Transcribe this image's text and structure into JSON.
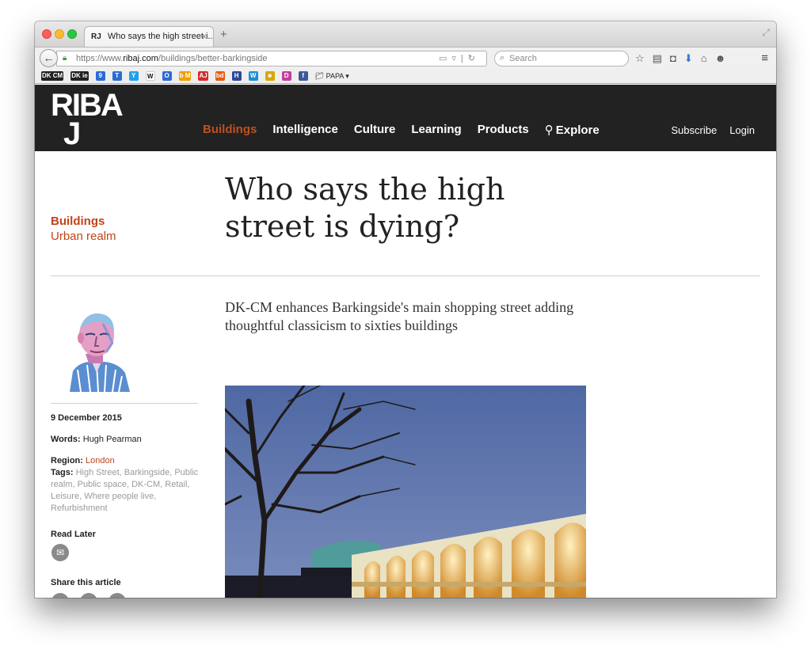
{
  "browser": {
    "tab_favicon": "RJ",
    "tab_title": "Who says the high street i...",
    "tab_close": "×",
    "new_tab": "+",
    "url_prefix": "https://www.",
    "url_host": "ribaj.com",
    "url_path": "/buildings/better-barkingside",
    "search_placeholder": "Search",
    "bookmarks": [
      {
        "label": "DK CM",
        "color": "#222222"
      },
      {
        "label": "DK ie",
        "color": "#222222"
      },
      {
        "label": "9",
        "color": "#2b6bd6"
      },
      {
        "label": "T",
        "color": "#2b6bd6"
      },
      {
        "label": "Y",
        "color": "#1da1f2"
      },
      {
        "label": "W",
        "color": "#ffffff"
      },
      {
        "label": "O",
        "color": "#2b6bd6"
      },
      {
        "label": "b M",
        "color": "#f0a000"
      },
      {
        "label": "AJ",
        "color": "#d72a2a"
      },
      {
        "label": "bd",
        "color": "#e85c0d"
      },
      {
        "label": "H",
        "color": "#2a4a9a"
      },
      {
        "label": "W",
        "color": "#1a8fd8"
      },
      {
        "label": "■",
        "color": "#d8a800"
      },
      {
        "label": "D",
        "color": "#c040a0"
      },
      {
        "label": "f",
        "color": "#3b5998"
      }
    ],
    "bookmark_folder": "PAPA"
  },
  "site": {
    "logo_line1": "RIBA",
    "logo_line2": "J",
    "nav": [
      "Buildings",
      "Intelligence",
      "Culture",
      "Learning",
      "Products"
    ],
    "nav_explore": "Explore",
    "subscribe": "Subscribe",
    "login": "Login",
    "accent_color": "#c0441a"
  },
  "article": {
    "category": "Buildings",
    "subcategory": "Urban realm",
    "headline": "Who says the high street is dying?",
    "standfirst": "DK-CM enhances Barkingside's main shopping street adding thoughtful classicism to sixties buildings",
    "date": "9 December 2015",
    "words_label": "Words:",
    "words_value": "Hugh Pearman",
    "region_label": "Region:",
    "region_value": "London",
    "tags_label": "Tags:",
    "tags_value": "High Street, Barkingside, Public realm, Public space, DK-CM, Retail, Leisure, Where people live, Refurbishment",
    "read_later": "Read Later",
    "share": "Share this article"
  }
}
